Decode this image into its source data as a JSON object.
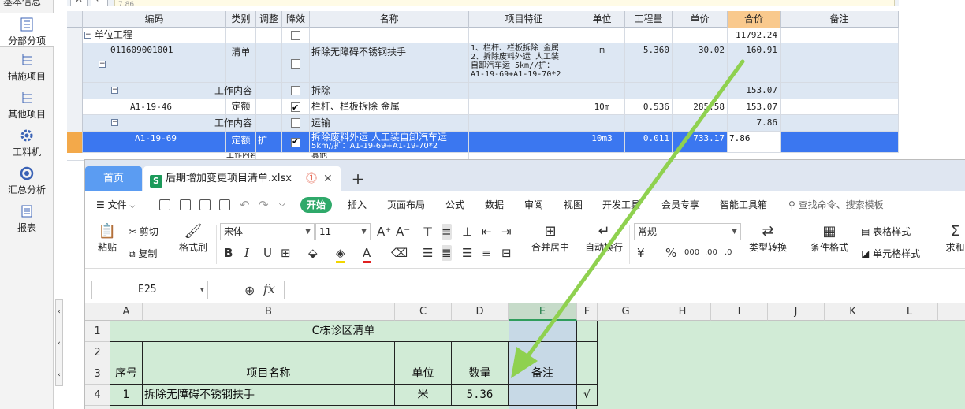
{
  "left_nav": {
    "top_label": "基本信息",
    "items": [
      {
        "label": "分部分项",
        "icon": "list-icon"
      },
      {
        "label": "措施项目",
        "icon": "tree-list-icon"
      },
      {
        "label": "其他项目",
        "icon": "tree-list-icon"
      },
      {
        "label": "工料机",
        "icon": "gear-icon"
      },
      {
        "label": "汇总分析",
        "icon": "circle-icon"
      },
      {
        "label": "报表",
        "icon": "report-icon"
      }
    ]
  },
  "top_grid": {
    "toolbar_value": "7.86",
    "columns": [
      "编码",
      "类别",
      "调整",
      "降效",
      "名称",
      "项目特征",
      "单位",
      "工程量",
      "单价",
      "合价",
      "备注"
    ],
    "rows": [
      {
        "code": "单位工程",
        "type": "",
        "adjust": "",
        "name": "",
        "feature": "",
        "unit": "",
        "qty": "",
        "price": "",
        "total": "11792.24"
      },
      {
        "code": "011609001001",
        "type": "清单",
        "adjust": "",
        "name": "拆除无障碍不锈钢扶手",
        "feature": [
          "1、栏杆、栏板拆除 金属",
          "2、拆除废料外运 人工装",
          "自卸汽车运 5km//扩：",
          "A1-19-69+A1-19-70*2"
        ],
        "unit": "m",
        "qty": "5.360",
        "price": "30.02",
        "total": "160.91"
      },
      {
        "code": "",
        "type": "工作内容",
        "adjust": "",
        "name": "拆除",
        "feature": "",
        "unit": "",
        "qty": "",
        "price": "",
        "total": "153.07"
      },
      {
        "code": "A1-19-46",
        "type": "定额",
        "adjust": "",
        "name": "栏杆、栏板拆除 金属",
        "feature": "",
        "unit": "10m",
        "qty": "0.536",
        "price": "285.58",
        "total": "153.07"
      },
      {
        "code": "",
        "type": "工作内容",
        "adjust": "",
        "name": "运输",
        "feature": "",
        "unit": "",
        "qty": "",
        "price": "",
        "total": "7.86"
      },
      {
        "code": "A1-19-69",
        "type": "定额",
        "adjust": "扩",
        "name": "拆除废料外运 人工装自卸汽车运",
        "name2": "5km//扩：A1-19-69+A1-19-70*2",
        "feature": "",
        "unit": "10m3",
        "qty": "0.011",
        "price": "733.17",
        "total": "7.86"
      },
      {
        "code": "",
        "type": "工作内容",
        "adjust": "",
        "name": "其他",
        "feature": "",
        "unit": "",
        "qty": "",
        "price": "",
        "total": ""
      }
    ]
  },
  "wps": {
    "tabs": {
      "home": "首页",
      "file": "后期增加变更项目清单.xlsx",
      "add": "+",
      "close": "✕",
      "alert": "!"
    },
    "menu": {
      "file": "文件",
      "items": [
        "开始",
        "插入",
        "页面布局",
        "公式",
        "数据",
        "审阅",
        "视图",
        "开发工具",
        "会员专享",
        "智能工具箱"
      ],
      "search_placeholder": "查找命令、搜索模板"
    },
    "ribbon": {
      "paste": "粘贴",
      "cut": "剪切",
      "copy": "复制",
      "format_painter": "格式刷",
      "font_name": "宋体",
      "font_size": "11",
      "merge_center": "合并居中",
      "wrap": "自动换行",
      "number_format": "常规",
      "type_convert": "类型转换",
      "conditional_format": "条件格式",
      "table_style": "表格样式",
      "cell_style": "单元格样式",
      "sum": "求和"
    },
    "name_box": "E25",
    "fx": "fx",
    "sheet": {
      "columns": [
        "A",
        "B",
        "C",
        "D",
        "E",
        "F",
        "G",
        "H",
        "I",
        "J",
        "K",
        "L"
      ],
      "rows": [
        "1",
        "2",
        "3",
        "4"
      ],
      "title": "C栋诊区清单",
      "header": {
        "seq": "序号",
        "name": "项目名称",
        "unit": "单位",
        "qty": "数量",
        "remark": "备注"
      },
      "data": [
        {
          "seq": "1",
          "name": "拆除无障碍不锈钢扶手",
          "unit": "米",
          "qty": "5.36",
          "remark": "",
          "f": "√"
        }
      ]
    },
    "colors": {
      "accent": "#2fa96a",
      "selection": "#3b77f0",
      "arrow": "#8fd14f"
    }
  }
}
